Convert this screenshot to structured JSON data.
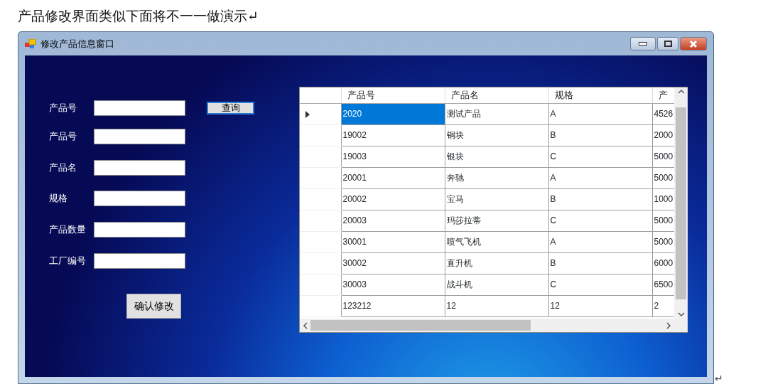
{
  "document": {
    "heading": "产品修改界面类似下面将不一一做演示↵",
    "trailing_mark": "↵"
  },
  "window": {
    "title": "修改产品信息窗口"
  },
  "form": {
    "fields": [
      {
        "label": "产品号"
      },
      {
        "label": "产品号"
      },
      {
        "label": "产品名"
      },
      {
        "label": "规格"
      },
      {
        "label": "产品数量"
      },
      {
        "label": "工厂编号"
      }
    ],
    "query_button": "查询",
    "confirm_button": "确认修改"
  },
  "table": {
    "columns": [
      "产品号",
      "产品名",
      "规格",
      "产"
    ],
    "rows": [
      {
        "selected": true,
        "cells": [
          "2020",
          "测试产品",
          "A",
          "4526"
        ]
      },
      {
        "selected": false,
        "cells": [
          "19002",
          "铜块",
          "B",
          "2000"
        ]
      },
      {
        "selected": false,
        "cells": [
          "19003",
          "银块",
          "C",
          "5000"
        ]
      },
      {
        "selected": false,
        "cells": [
          "20001",
          "奔驰",
          "A",
          "5000"
        ]
      },
      {
        "selected": false,
        "cells": [
          "20002",
          "宝马",
          "B",
          "1000"
        ]
      },
      {
        "selected": false,
        "cells": [
          "20003",
          "玛莎拉蒂",
          "C",
          "5000"
        ]
      },
      {
        "selected": false,
        "cells": [
          "30001",
          "喷气飞机",
          "A",
          "5000"
        ]
      },
      {
        "selected": false,
        "cells": [
          "30002",
          "直升机",
          "B",
          "6000"
        ]
      },
      {
        "selected": false,
        "cells": [
          "30003",
          "战斗机",
          "C",
          "6500"
        ]
      },
      {
        "selected": false,
        "cells": [
          "123212",
          "12",
          "12",
          "2"
        ]
      }
    ]
  }
}
